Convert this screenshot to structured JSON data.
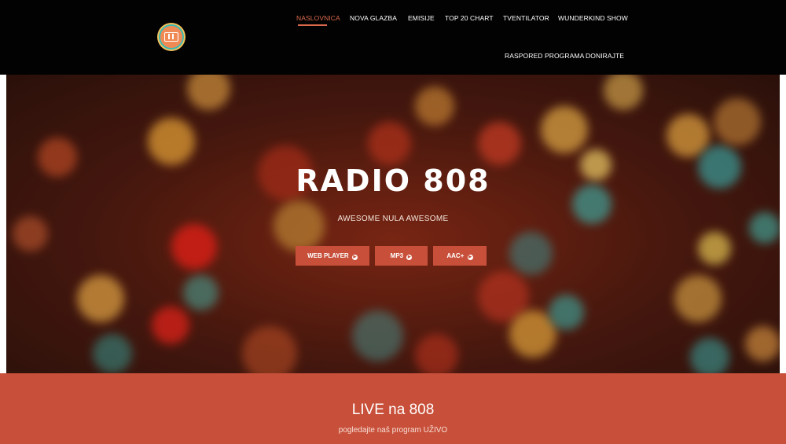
{
  "header": {
    "logo_icon": "radio-808-logo-icon",
    "nav": [
      {
        "label": "NASLOVNICA",
        "active": true
      },
      {
        "label": "NOVA GLAZBA",
        "active": false
      },
      {
        "label": "EMISIJE",
        "active": false
      },
      {
        "label": "TOP 20 CHART",
        "active": false
      },
      {
        "label": "TVENTILATOR",
        "active": false
      },
      {
        "label": "WUNDERKIND SHOW",
        "active": false
      },
      {
        "label": "RASPORED PROGRAMA",
        "active": false
      },
      {
        "label": "DONIRAJTE",
        "active": false
      }
    ],
    "accent_color": "#d9694c",
    "background_color": "#020202"
  },
  "hero": {
    "title": "RADIO 808",
    "subtitle": "AWESOME NULA AWESOME",
    "background": "bokeh-lights-image",
    "buttons": [
      {
        "label": "WEB PLAYER",
        "icon": "arrow-right-circle-icon"
      },
      {
        "label": "MP3",
        "icon": "arrow-right-circle-icon"
      },
      {
        "label": "AAC+",
        "icon": "arrow-right-circle-icon"
      }
    ],
    "button_color": "#c8503a"
  },
  "live": {
    "title": "LIVE na 808",
    "subtitle": "pogledajte naš program UŽIVO",
    "background_color": "#c8503a"
  }
}
